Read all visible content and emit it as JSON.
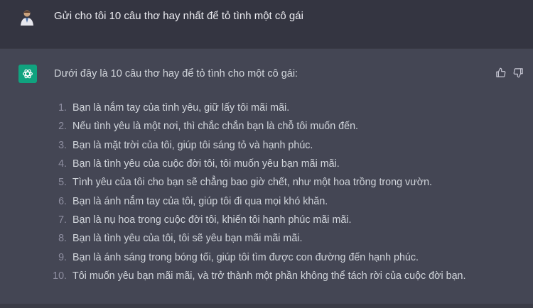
{
  "user_message": {
    "text": "Gửi cho tôi 10 câu thơ hay nhất để tỏ tình một cô gái"
  },
  "assistant_message": {
    "intro": "Dưới đây là 10 câu thơ hay để tỏ tình cho một cô gái:",
    "items": [
      {
        "num": "1.",
        "text": "Bạn là nắm tay của tình yêu, giữ lấy tôi mãi mãi."
      },
      {
        "num": "2.",
        "text": "Nếu tình yêu là một nơi, thì chắc chắn bạn là chỗ tôi muốn đến."
      },
      {
        "num": "3.",
        "text": "Bạn là mặt trời của tôi, giúp tôi sáng tỏ và hạnh phúc."
      },
      {
        "num": "4.",
        "text": "Bạn là tình yêu của cuộc đời tôi, tôi muốn yêu bạn mãi mãi."
      },
      {
        "num": "5.",
        "text": "Tình yêu của tôi cho bạn sẽ chẳng bao giờ chết, như một hoa trồng trong vườn."
      },
      {
        "num": "6.",
        "text": "Bạn là ánh nắm tay của tôi, giúp tôi đi qua mọi khó khăn."
      },
      {
        "num": "7.",
        "text": "Bạn là nụ hoa trong cuộc đời tôi, khiến tôi hạnh phúc mãi mãi."
      },
      {
        "num": "8.",
        "text": "Bạn là tình yêu của tôi, tôi sẽ yêu bạn mãi mãi mãi."
      },
      {
        "num": "9.",
        "text": "Bạn là ánh sáng trong bóng tối, giúp tôi tìm được con đường đến hạnh phúc."
      },
      {
        "num": "10.",
        "text": "Tôi muốn yêu bạn mãi mãi, và trở thành một phần không thể tách rời của cuộc đời bạn."
      }
    ]
  },
  "icons": {
    "user_avatar": "user-avatar-icon",
    "assistant_avatar": "openai-logo-icon",
    "thumbs_up": "thumbs-up-icon",
    "thumbs_down": "thumbs-down-icon"
  },
  "colors": {
    "background": "#343541",
    "assistant_background": "#444654",
    "accent": "#10a37f"
  }
}
